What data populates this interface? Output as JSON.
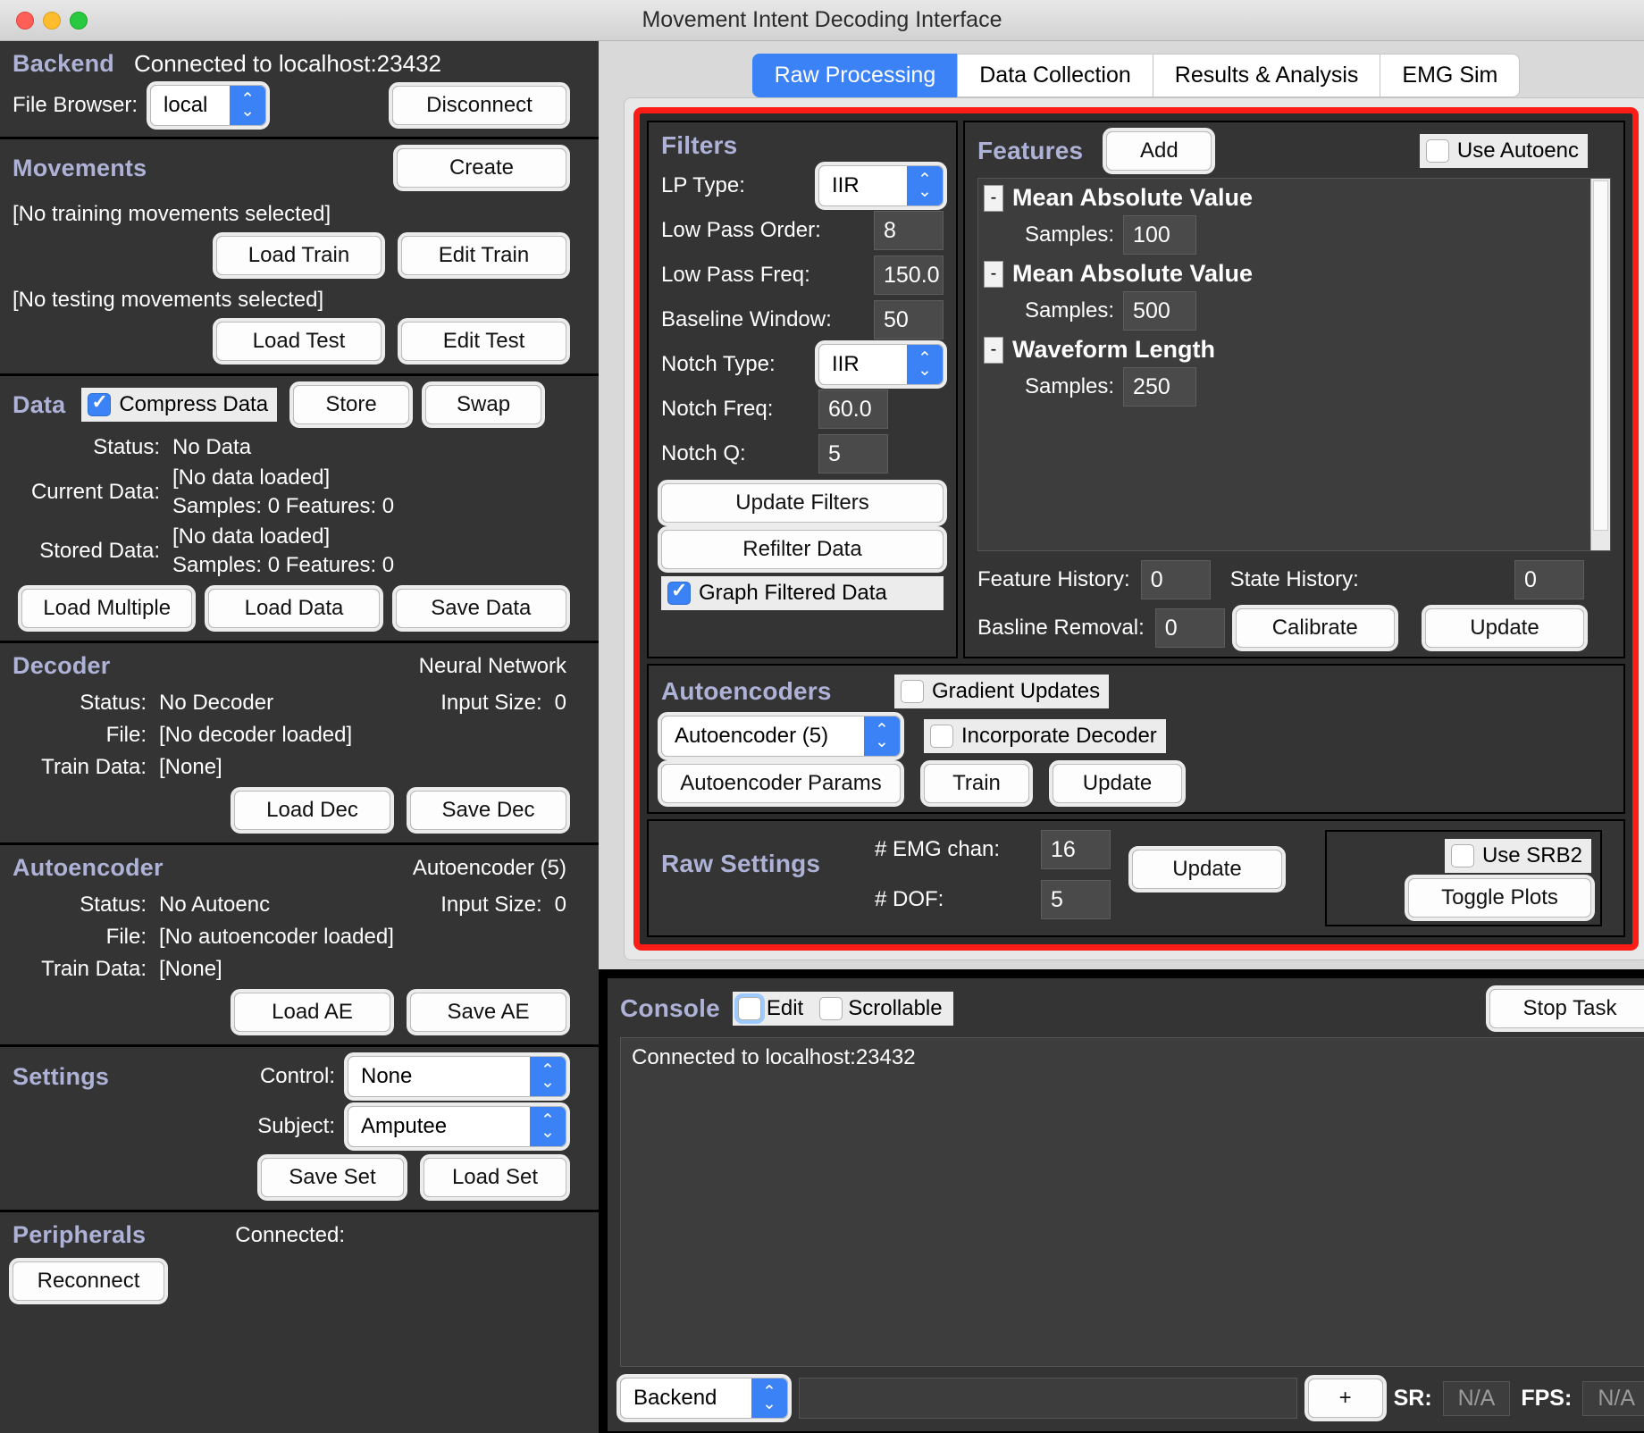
{
  "window": {
    "title": "Movement Intent Decoding Interface"
  },
  "backend": {
    "title": "Backend",
    "status": "Connected to localhost:23432",
    "file_browser_label": "File Browser:",
    "file_browser_value": "local",
    "disconnect_label": "Disconnect"
  },
  "movements": {
    "title": "Movements",
    "create_label": "Create",
    "train_status": "[No training movements selected]",
    "load_train_label": "Load Train",
    "edit_train_label": "Edit Train",
    "test_status": "[No testing movements selected]",
    "load_test_label": "Load Test",
    "edit_test_label": "Edit Test"
  },
  "data": {
    "title": "Data",
    "compress_label": "Compress Data",
    "compress_checked": true,
    "store_label": "Store",
    "swap_label": "Swap",
    "status_label": "Status:",
    "status_value": "No Data",
    "current_label": "Current Data:",
    "current_file": "[No data loaded]",
    "current_counts": "Samples: 0  Features: 0",
    "stored_label": "Stored Data:",
    "stored_file": "[No data loaded]",
    "stored_counts": "Samples: 0  Features: 0",
    "load_multiple_label": "Load Multiple",
    "load_data_label": "Load Data",
    "save_data_label": "Save Data"
  },
  "decoder": {
    "title": "Decoder",
    "type": "Neural Network",
    "status_label": "Status:",
    "status_value": "No Decoder",
    "input_size_label": "Input Size:",
    "input_size_value": "0",
    "file_label": "File:",
    "file_value": "[No decoder loaded]",
    "train_data_label": "Train Data:",
    "train_data_value": "[None]",
    "load_label": "Load Dec",
    "save_label": "Save Dec"
  },
  "autoencoder": {
    "title": "Autoencoder",
    "type": "Autoencoder (5)",
    "status_label": "Status:",
    "status_value": "No Autoenc",
    "input_size_label": "Input Size:",
    "input_size_value": "0",
    "file_label": "File:",
    "file_value": "[No autoencoder loaded]",
    "train_data_label": "Train Data:",
    "train_data_value": "[None]",
    "load_label": "Load AE",
    "save_label": "Save AE"
  },
  "settings": {
    "title": "Settings",
    "control_label": "Control:",
    "control_value": "None",
    "subject_label": "Subject:",
    "subject_value": "Amputee",
    "save_set_label": "Save Set",
    "load_set_label": "Load Set"
  },
  "peripherals": {
    "title": "Peripherals",
    "connected_label": "Connected:",
    "reconnect_label": "Reconnect"
  },
  "tabs": [
    {
      "label": "Raw Processing",
      "active": true
    },
    {
      "label": "Data Collection",
      "active": false
    },
    {
      "label": "Results & Analysis",
      "active": false
    },
    {
      "label": "EMG Sim",
      "active": false
    }
  ],
  "filters": {
    "title": "Filters",
    "lp_type_label": "LP Type:",
    "lp_type_value": "IIR",
    "lp_order_label": "Low Pass Order:",
    "lp_order_value": "8",
    "lp_freq_label": "Low Pass Freq:",
    "lp_freq_value": "150.0",
    "baseline_window_label": "Baseline Window:",
    "baseline_window_value": "50",
    "notch_type_label": "Notch Type:",
    "notch_type_value": "IIR",
    "notch_freq_label": "Notch Freq:",
    "notch_freq_value": "60.0",
    "notch_q_label": "Notch Q:",
    "notch_q_value": "5",
    "update_filters_label": "Update Filters",
    "refilter_label": "Refilter Data",
    "graph_filtered_label": "Graph Filtered Data",
    "graph_filtered_checked": true
  },
  "features": {
    "title": "Features",
    "add_label": "Add",
    "use_autoenc_label": "Use Autoenc",
    "use_autoenc_checked": false,
    "samples_label": "Samples:",
    "items": [
      {
        "name": "Mean Absolute Value",
        "samples": "100"
      },
      {
        "name": "Mean Absolute Value",
        "samples": "500"
      },
      {
        "name": "Waveform Length",
        "samples": "250"
      }
    ],
    "feature_history_label": "Feature History:",
    "feature_history_value": "0",
    "state_history_label": "State History:",
    "state_history_value": "0",
    "baseline_removal_label": "Basline Removal:",
    "baseline_removal_value": "0",
    "calibrate_label": "Calibrate",
    "update_label": "Update"
  },
  "autoencoders": {
    "title": "Autoencoders",
    "gradient_updates_label": "Gradient Updates",
    "gradient_updates_checked": false,
    "selected": "Autoencoder (5)",
    "incorporate_decoder_label": "Incorporate Decoder",
    "incorporate_decoder_checked": false,
    "params_label": "Autoencoder Params",
    "train_label": "Train",
    "update_label": "Update"
  },
  "raw_settings": {
    "title": "Raw Settings",
    "emg_chan_label": "# EMG chan:",
    "emg_chan_value": "16",
    "dof_label": "# DOF:",
    "dof_value": "5",
    "update_label": "Update",
    "use_srb2_label": "Use SRB2",
    "use_srb2_checked": false,
    "toggle_plots_label": "Toggle Plots"
  },
  "console": {
    "title": "Console",
    "edit_label": "Edit",
    "edit_checked": false,
    "scrollable_label": "Scrollable",
    "scrollable_checked": false,
    "stop_task_label": "Stop Task",
    "output": "Connected to localhost:23432",
    "target_value": "Backend",
    "add_label": "+",
    "sr_label": "SR:",
    "sr_value": "N/A",
    "fps_label": "FPS:",
    "fps_value": "N/A"
  },
  "colors": {
    "accent_blue": "#3b82f6",
    "highlight_red": "#fd1d17",
    "panel_bg": "#343434",
    "group_heading": "#aeb2d6"
  }
}
